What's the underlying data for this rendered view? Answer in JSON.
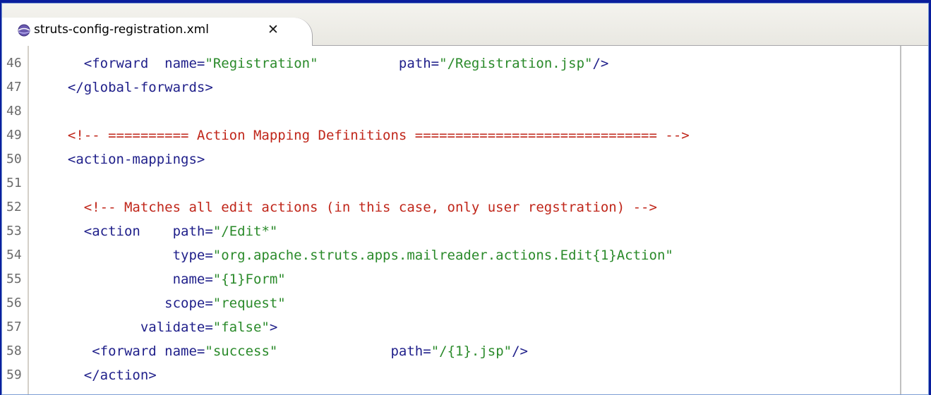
{
  "tab": {
    "title": "struts-config-registration.xml",
    "close": "✕",
    "icon": "xml-file-icon"
  },
  "lines": [
    {
      "num": "46",
      "parts": [
        {
          "t": "    ",
          "c": "tag"
        },
        {
          "t": "<forward",
          "c": "tag"
        },
        {
          "t": "  ",
          "c": "tag"
        },
        {
          "t": "name=",
          "c": "tag"
        },
        {
          "t": "\"Registration\"",
          "c": "val"
        },
        {
          "t": "          ",
          "c": "tag"
        },
        {
          "t": "path=",
          "c": "tag"
        },
        {
          "t": "\"/Registration.jsp\"",
          "c": "val"
        },
        {
          "t": "/>",
          "c": "tag"
        }
      ]
    },
    {
      "num": "47",
      "parts": [
        {
          "t": "  ",
          "c": "tag"
        },
        {
          "t": "</global-forwards>",
          "c": "tag"
        }
      ]
    },
    {
      "num": "48",
      "parts": []
    },
    {
      "num": "49",
      "parts": [
        {
          "t": "  ",
          "c": "cmt"
        },
        {
          "t": "<!-- ========== Action Mapping Definitions ============================== -->",
          "c": "cmt"
        }
      ]
    },
    {
      "num": "50",
      "parts": [
        {
          "t": "  ",
          "c": "tag"
        },
        {
          "t": "<action-mappings>",
          "c": "tag"
        }
      ]
    },
    {
      "num": "51",
      "parts": []
    },
    {
      "num": "52",
      "parts": [
        {
          "t": "    ",
          "c": "cmt"
        },
        {
          "t": "<!-- Matches all edit actions (in this case, only user regstration) -->",
          "c": "cmt"
        }
      ]
    },
    {
      "num": "53",
      "parts": [
        {
          "t": "    ",
          "c": "tag"
        },
        {
          "t": "<action",
          "c": "tag"
        },
        {
          "t": "    ",
          "c": "tag"
        },
        {
          "t": "path=",
          "c": "tag"
        },
        {
          "t": "\"/Edit*\"",
          "c": "val"
        }
      ]
    },
    {
      "num": "54",
      "parts": [
        {
          "t": "               ",
          "c": "tag"
        },
        {
          "t": "type=",
          "c": "tag"
        },
        {
          "t": "\"org.apache.struts.apps.mailreader.actions.Edit{1}Action\"",
          "c": "val"
        }
      ]
    },
    {
      "num": "55",
      "parts": [
        {
          "t": "               ",
          "c": "tag"
        },
        {
          "t": "name=",
          "c": "tag"
        },
        {
          "t": "\"{1}Form\"",
          "c": "val"
        }
      ]
    },
    {
      "num": "56",
      "parts": [
        {
          "t": "              ",
          "c": "tag"
        },
        {
          "t": "scope=",
          "c": "tag"
        },
        {
          "t": "\"request\"",
          "c": "val"
        }
      ]
    },
    {
      "num": "57",
      "parts": [
        {
          "t": "           ",
          "c": "tag"
        },
        {
          "t": "validate=",
          "c": "tag"
        },
        {
          "t": "\"false\"",
          "c": "val"
        },
        {
          "t": ">",
          "c": "tag"
        }
      ]
    },
    {
      "num": "58",
      "parts": [
        {
          "t": "     ",
          "c": "tag"
        },
        {
          "t": "<forward",
          "c": "tag"
        },
        {
          "t": " ",
          "c": "tag"
        },
        {
          "t": "name=",
          "c": "tag"
        },
        {
          "t": "\"success\"",
          "c": "val"
        },
        {
          "t": "              ",
          "c": "tag"
        },
        {
          "t": "path=",
          "c": "tag"
        },
        {
          "t": "\"/{1}.jsp\"",
          "c": "val"
        },
        {
          "t": "/>",
          "c": "tag"
        }
      ]
    },
    {
      "num": "59",
      "parts": [
        {
          "t": "    ",
          "c": "tag"
        },
        {
          "t": "</action>",
          "c": "tag"
        }
      ]
    }
  ]
}
